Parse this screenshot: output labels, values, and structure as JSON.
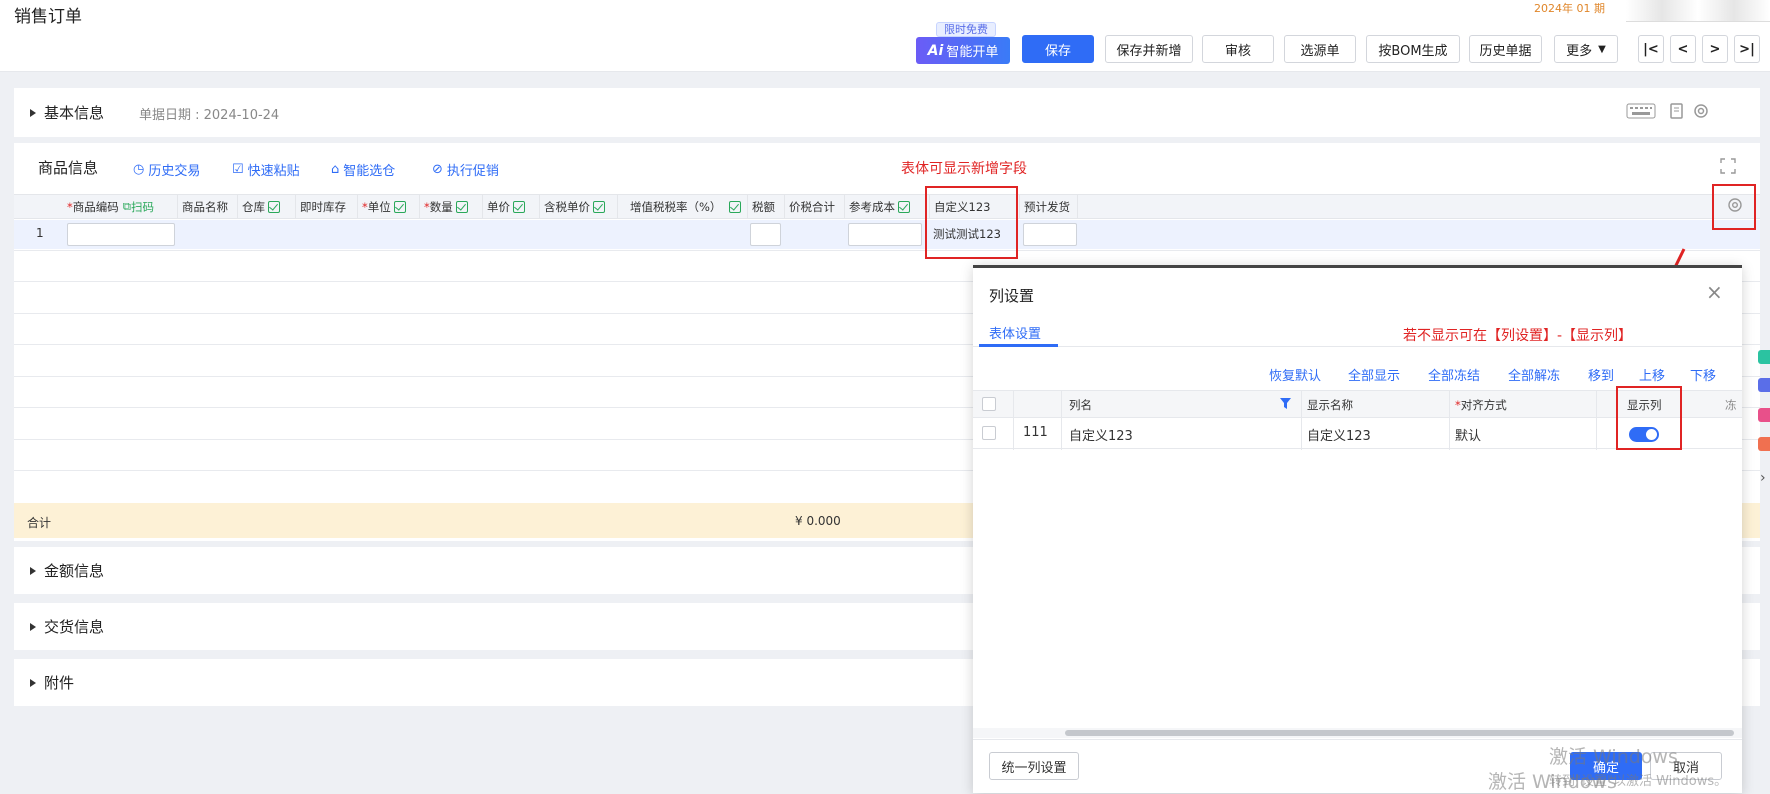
{
  "page": {
    "title": "销售订单",
    "period": "2024年 01 期"
  },
  "toolbar": {
    "ai_tag": "限时免费",
    "ai_label": "智能开单",
    "save": "保存",
    "save_new": "保存并新增",
    "review": "审核",
    "select_source": "选源单",
    "bom": "按BOM生成",
    "history": "历史单据",
    "more": "更多",
    "nav_first": "|<",
    "nav_prev": "<",
    "nav_next": ">",
    "nav_last": ">|"
  },
  "basic": {
    "title": "基本信息",
    "date_label": "单据日期 : 2024-10-24"
  },
  "goods": {
    "title": "商品信息",
    "links": [
      "历史交易",
      "快速粘贴",
      "智能选仓",
      "执行促销"
    ],
    "annotation": "表体可显示新增字段",
    "columns": [
      "商品编码",
      "扫码",
      "商品名称",
      "仓库",
      "即时库存",
      "单位",
      "数量",
      "单价",
      "含税单价",
      "增值税税率（%）",
      "税额",
      "价税合计",
      "参考成本",
      "自定义123",
      "预计发货"
    ],
    "row_no": "1",
    "custom_value": "测试测试123",
    "total_label": "合计",
    "total_amount": "¥ 0.000"
  },
  "sections": {
    "amount": "金额信息",
    "delivery": "交货信息",
    "attachment": "附件"
  },
  "dialog": {
    "title": "列设置",
    "tab": "表体设置",
    "annotation": "若不显示可在【列设置】-【显示列】",
    "actions": [
      "恢复默认",
      "全部显示",
      "全部冻结",
      "全部解冻",
      "移到",
      "上移",
      "下移"
    ],
    "headers": {
      "name": "列名",
      "display": "显示名称",
      "align": "对齐方式",
      "show": "显示列",
      "extra": "冻"
    },
    "row": {
      "index": "111",
      "name": "自定义123",
      "display": "自定义123",
      "align": "默认"
    },
    "unified": "统一列设置",
    "confirm": "确定",
    "cancel": "取消",
    "watermark1": "激活 Windows",
    "watermark2": "转到\"设置\"以激活 Windows。",
    "watermark3": "激活 Windows"
  },
  "colors": {
    "primary": "#2f6cf6",
    "annotation_red": "#e02424",
    "total_bg": "#fdf1d6"
  }
}
